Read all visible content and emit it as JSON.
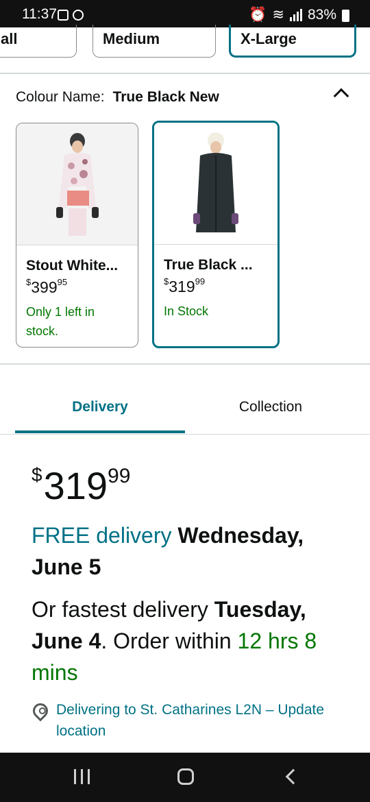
{
  "status_bar": {
    "time": "11:37",
    "battery": "83%"
  },
  "sizes": [
    {
      "label": "all",
      "selected": false
    },
    {
      "label": "Medium",
      "selected": false
    },
    {
      "label": "X-Large",
      "selected": true
    }
  ],
  "colour": {
    "label": "Colour Name:",
    "value": "True Black New"
  },
  "swatches": [
    {
      "name": "Stout White...",
      "currency": "$",
      "dollars": "399",
      "cents": "95",
      "stock": "Only 1 left in stock.",
      "selected": false
    },
    {
      "name": "True Black ...",
      "currency": "$",
      "dollars": "319",
      "cents": "99",
      "stock": "In Stock",
      "selected": true
    }
  ],
  "tabs": {
    "delivery": "Delivery",
    "collection": "Collection"
  },
  "price": {
    "currency": "$",
    "dollars": "319",
    "cents": "99"
  },
  "delivery": {
    "free_label": "FREE delivery",
    "free_date": "Wednesday, June 5",
    "fastest_prefix": "Or fastest delivery",
    "fastest_date": "Tuesday, June 4",
    "order_within": ". Order within",
    "countdown": "12 hrs 8 mins"
  },
  "location": {
    "text": "Delivering to St. Catharines L2N – Update location"
  },
  "colors": {
    "teal": "#007185",
    "green": "#007600"
  }
}
